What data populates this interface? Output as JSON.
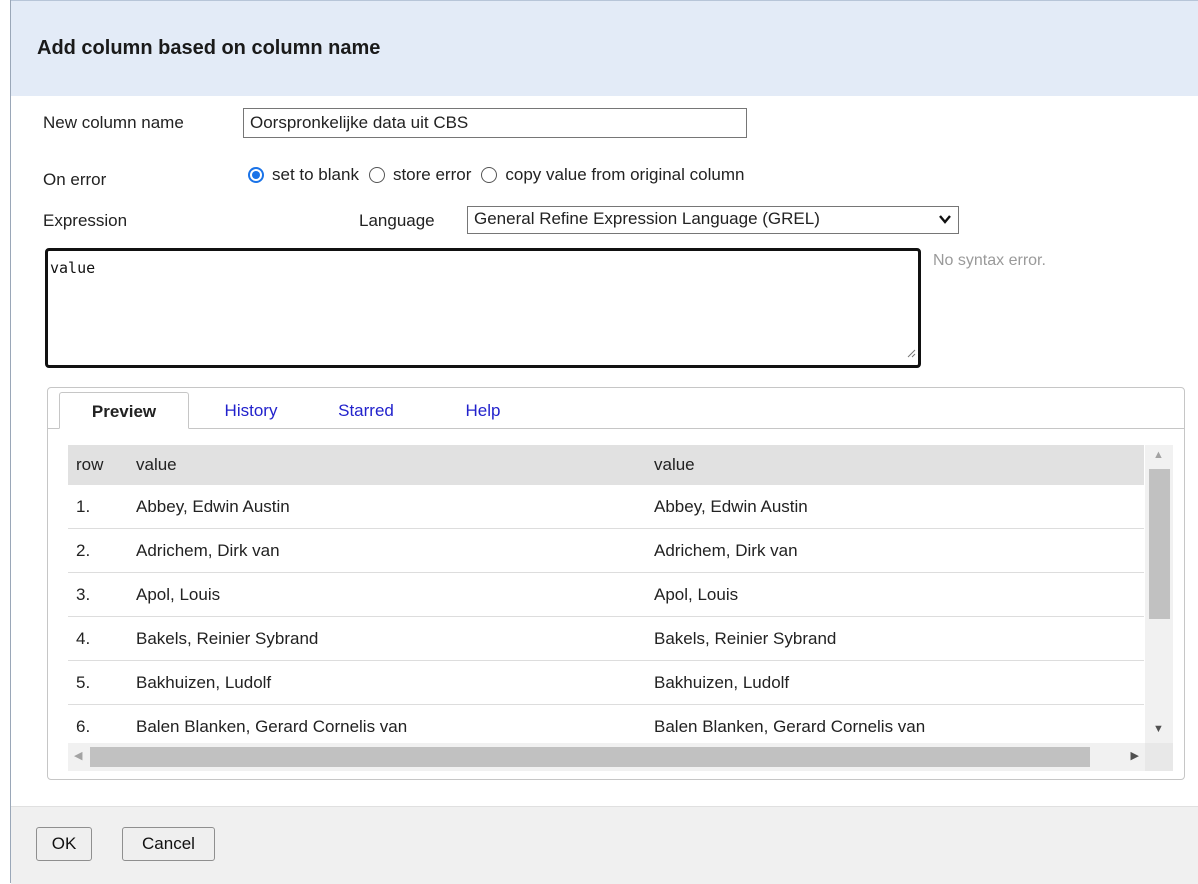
{
  "dialog": {
    "title": "Add column based on column name",
    "new_column_label": "New column name",
    "new_column_value": "Oorspronkelijke data uit CBS",
    "on_error_label": "On error",
    "on_error_options": [
      {
        "label": "set to blank",
        "checked": true
      },
      {
        "label": "store error",
        "checked": false
      },
      {
        "label": "copy value from original column",
        "checked": false
      }
    ],
    "expression_label": "Expression",
    "language_label": "Language",
    "language_value": "General Refine Expression Language (GREL)",
    "expression_value": "value",
    "syntax_status": "No syntax error."
  },
  "tabs": [
    {
      "label": "Preview",
      "active": true
    },
    {
      "label": "History",
      "active": false
    },
    {
      "label": "Starred",
      "active": false
    },
    {
      "label": "Help",
      "active": false
    }
  ],
  "preview": {
    "headers": [
      "row",
      "value",
      "value"
    ],
    "rows": [
      [
        "1.",
        "Abbey, Edwin Austin",
        "Abbey, Edwin Austin"
      ],
      [
        "2.",
        "Adrichem, Dirk van",
        "Adrichem, Dirk van"
      ],
      [
        "3.",
        "Apol, Louis",
        "Apol, Louis"
      ],
      [
        "4.",
        "Bakels, Reinier Sybrand",
        "Bakels, Reinier Sybrand"
      ],
      [
        "5.",
        "Bakhuizen, Ludolf",
        "Bakhuizen, Ludolf"
      ],
      [
        "6.",
        "Balen Blanken, Gerard Cornelis van",
        "Balen Blanken, Gerard Cornelis van"
      ]
    ]
  },
  "footer": {
    "ok_label": "OK",
    "cancel_label": "Cancel"
  },
  "colors": {
    "header_bg": "#e3ebf7",
    "radio_accent": "#1a73e8",
    "link": "#2222cc"
  }
}
